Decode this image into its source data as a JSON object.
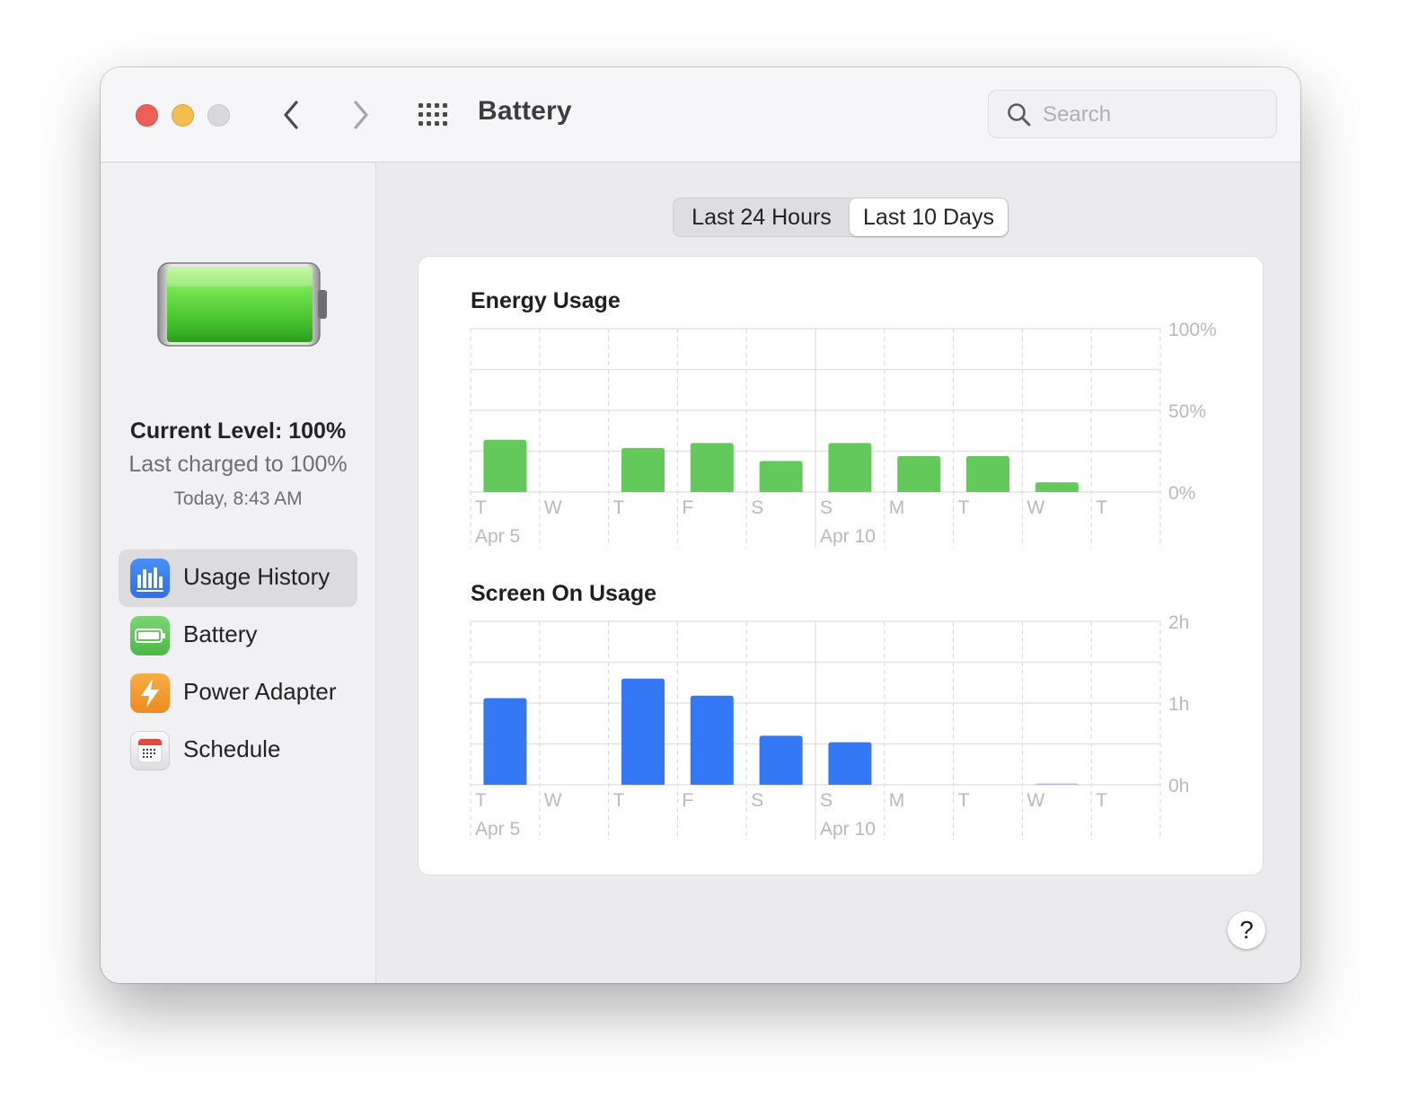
{
  "window": {
    "title": "Battery"
  },
  "search": {
    "placeholder": "Search"
  },
  "status": {
    "current_level": "Current Level: 100%",
    "last_charged": "Last charged to 100%",
    "charged_time": "Today, 8:43 AM",
    "battery_level_fraction": 1.0
  },
  "sidebar": {
    "items": [
      {
        "label": "Usage History",
        "icon": "usage-history-icon",
        "color": "#3478f6",
        "selected": true
      },
      {
        "label": "Battery",
        "icon": "battery-icon",
        "color": "#5dc55a",
        "selected": false
      },
      {
        "label": "Power Adapter",
        "icon": "power-adapter-icon",
        "color": "#f39b2e",
        "selected": false
      },
      {
        "label": "Schedule",
        "icon": "calendar-icon",
        "color": "#e9493b",
        "selected": false
      }
    ]
  },
  "segmented": {
    "options": [
      "Last 24 Hours",
      "Last 10 Days"
    ],
    "selected": "Last 10 Days"
  },
  "help_label": "?",
  "chart_data": [
    {
      "type": "bar",
      "title": "Energy Usage",
      "color": "#62c95a",
      "categories": [
        "T",
        "W",
        "T",
        "F",
        "S",
        "S",
        "M",
        "T",
        "W",
        "T"
      ],
      "date_labels": [
        "Apr 5",
        "",
        "",
        "",
        "",
        "Apr 10",
        "",
        "",
        "",
        ""
      ],
      "values": [
        32,
        0,
        27,
        30,
        19,
        30,
        22,
        22,
        6,
        0
      ],
      "yticks": [
        "100%",
        "50%",
        "0%"
      ],
      "ylim": [
        0,
        100
      ],
      "unit": "%",
      "grid": true
    },
    {
      "type": "bar",
      "title": "Screen On Usage",
      "color": "#3478f6",
      "categories": [
        "T",
        "W",
        "T",
        "F",
        "S",
        "S",
        "M",
        "T",
        "W",
        "T"
      ],
      "date_labels": [
        "Apr 5",
        "",
        "",
        "",
        "",
        "Apr 10",
        "",
        "",
        "",
        ""
      ],
      "values": [
        1.06,
        0,
        1.3,
        1.09,
        0.6,
        0.52,
        0,
        0,
        0.01,
        0
      ],
      "yticks": [
        "2h",
        "1h",
        "0h"
      ],
      "ylim": [
        0,
        2
      ],
      "unit": "h",
      "grid": true
    }
  ]
}
